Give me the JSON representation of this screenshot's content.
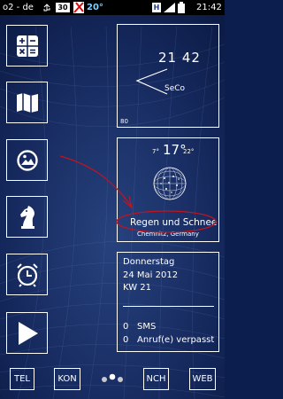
{
  "status_bar": {
    "carrier": "o2 - de",
    "badge_count": "30",
    "temperature": "20°",
    "time": "21:42"
  },
  "apps": [
    {
      "name": "calculator-icon"
    },
    {
      "name": "map-icon"
    },
    {
      "name": "gallery-icon"
    },
    {
      "name": "chess-knight-icon"
    },
    {
      "name": "alarm-clock-icon"
    },
    {
      "name": "play-store-icon"
    }
  ],
  "clock_widget": {
    "time": "21 42",
    "label": "SeCo",
    "battery": "80"
  },
  "weather_widget": {
    "low": "7°",
    "current": "17°",
    "high": "22°",
    "condition": "Regen und Schnee",
    "location": "Chemnitz, Germany"
  },
  "info_widget": {
    "weekday": "Donnerstag",
    "date": "24 Mai 2012",
    "week": "KW 21",
    "sms_count": "0",
    "sms_label": "SMS",
    "calls_count": "0",
    "calls_label": "Anruf(e) verpasst"
  },
  "dock": {
    "tel": "TEL",
    "kon": "KON",
    "nch": "NCH",
    "web": "WEB"
  },
  "colors": {
    "background": "#0c1e4e",
    "annotation": "#c01420",
    "badge_red": "#d01010"
  }
}
